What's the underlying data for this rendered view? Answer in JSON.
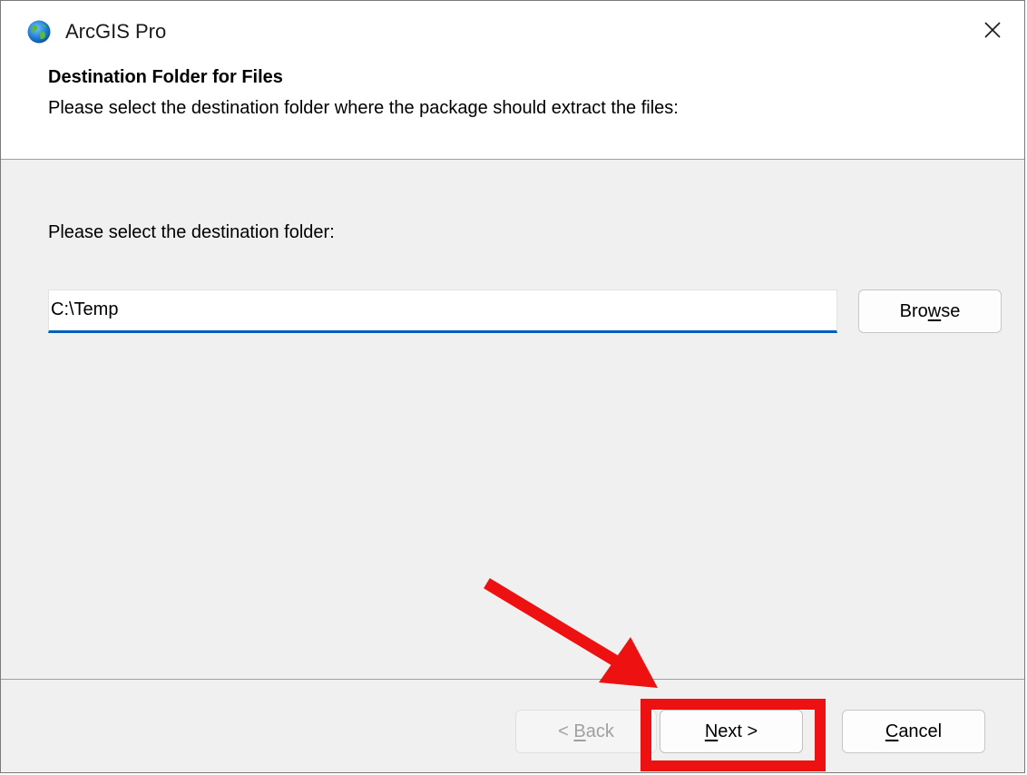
{
  "window": {
    "title": "ArcGIS Pro",
    "icon": "globe-icon",
    "close_icon": "close-icon"
  },
  "header": {
    "title": "Destination Folder for Files",
    "subtitle": "Please select the destination folder where the package should extract the files:"
  },
  "body": {
    "folder_label": "Please select the destination folder:",
    "path_value": "C:\\Temp",
    "browse_button": {
      "before": "Bro",
      "mnemonic": "w",
      "after": "se"
    }
  },
  "footer": {
    "back_button": {
      "before": "< ",
      "mnemonic": "B",
      "after": "ack",
      "enabled": false
    },
    "next_button": {
      "before": "",
      "mnemonic": "N",
      "after": "ext >"
    },
    "cancel_button": {
      "before": "",
      "mnemonic": "C",
      "after": "ancel"
    }
  },
  "annotation": {
    "highlight_color": "#ee1111",
    "target": "next-button"
  },
  "colors": {
    "accent": "#005fb8",
    "window_bg": "#f0f0f0",
    "header_bg": "#ffffff"
  }
}
